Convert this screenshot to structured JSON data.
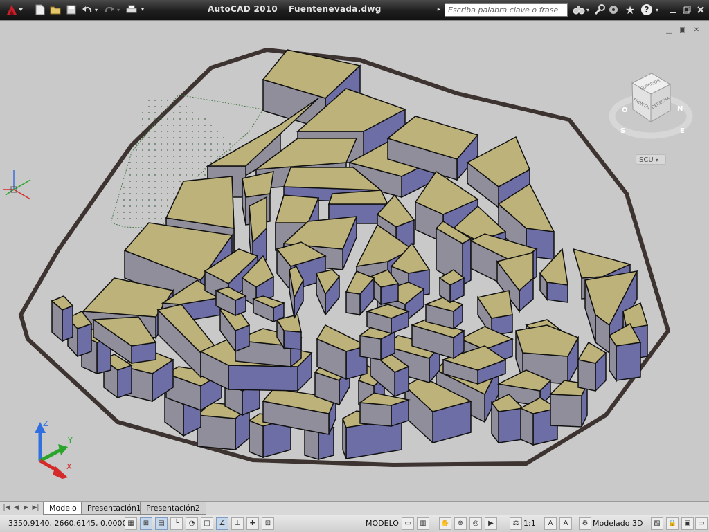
{
  "window": {
    "app_name": "AutoCAD 2010",
    "file_name": "Fuentenevada.dwg",
    "search_placeholder": "Escriba palabra clave o frase"
  },
  "viewcube": {
    "top_label": "SUPERIOR",
    "front_label": "FRONTAL",
    "right_label": "DERECHA",
    "compass": [
      "O",
      "N",
      "S",
      "E"
    ],
    "ucs_menu": "SCU"
  },
  "ucs_icon": {
    "z": "Z",
    "y": "Y",
    "x": "X"
  },
  "tabs": [
    {
      "label": "Modelo",
      "active": true
    },
    {
      "label": "Presentación1",
      "active": false
    },
    {
      "label": "Presentación2",
      "active": false
    }
  ],
  "status": {
    "coordinates": "3350.9140, 2660.6145, 0.0000",
    "model_label": "MODELO",
    "scale": "1:1",
    "workspace": "Modelado 3D"
  },
  "colors": {
    "block_top": "#bcb27a",
    "block_side_light": "#8f8e9a",
    "block_side_shadow": "#6e6ea6",
    "outline": "#3d3330",
    "background": "#c9c9c9"
  }
}
